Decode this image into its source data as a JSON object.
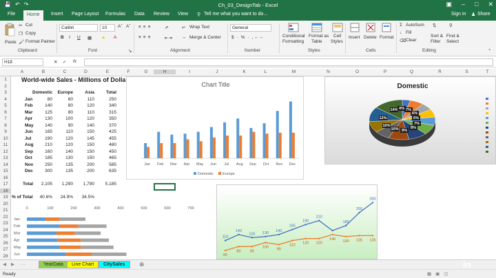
{
  "window": {
    "title": "Ch_03_DesignTab - Excel",
    "signin": "Sign in",
    "share": "Share"
  },
  "tabs": [
    "File",
    "Home",
    "Insert",
    "Page Layout",
    "Formulas",
    "Data",
    "Review",
    "View"
  ],
  "tell_me": "Tell me what you want to do...",
  "ribbon": {
    "cut": "Cut",
    "copy": "Copy",
    "format_painter": "Format Painter",
    "paste": "Paste",
    "font_name": "Calibri",
    "font_size": "10",
    "bold": "B",
    "italic": "I",
    "underline": "U",
    "wrap_text": "Wrap Text",
    "merge_center": "Merge & Center",
    "number_format": "General",
    "conditional_formatting": [
      "Conditional",
      "Formatting"
    ],
    "format_as_table": [
      "Format as",
      "Table"
    ],
    "cell_styles": [
      "Cell",
      "Styles"
    ],
    "insert": "Insert",
    "delete": "Delete",
    "format": "Format",
    "autosum": "AutoSum",
    "fill": "Fill",
    "clear": "Clear",
    "sort_filter": [
      "Sort &",
      "Filter"
    ],
    "find_select": [
      "Find &",
      "Select"
    ],
    "groups": [
      "Clipboard",
      "Font",
      "Alignment",
      "Number",
      "Styles",
      "Cells",
      "Editing"
    ]
  },
  "name_box": "H18",
  "fx": "fx",
  "columns": [
    "A",
    "B",
    "C",
    "D",
    "E",
    "F",
    "G",
    "H",
    "I",
    "J",
    "K",
    "L",
    "M",
    "N",
    "O",
    "P",
    "Q",
    "R",
    "S",
    "T",
    "U"
  ],
  "rows": [
    "1",
    "2",
    "3",
    "4",
    "5",
    "6",
    "7",
    "8",
    "9",
    "10",
    "11",
    "12",
    "13",
    "14",
    "15",
    "16",
    "17",
    "18",
    "19",
    "20",
    "21",
    "22",
    "23",
    "24",
    "25",
    "26",
    "27",
    "28"
  ],
  "sheet": {
    "title": "World-wide Sales - Millions of Dollar",
    "headers": [
      "Domestic",
      "Europe",
      "Asia",
      "Total"
    ],
    "months": [
      "Jan",
      "Feb",
      "Mar",
      "Apr",
      "May",
      "Jun",
      "Jul",
      "Aug",
      "Sep",
      "Oct",
      "Nov",
      "Dec"
    ],
    "data": [
      [
        "80",
        "60",
        "110",
        "250"
      ],
      [
        "140",
        "80",
        "120",
        "340"
      ],
      [
        "125",
        "80",
        "110",
        "315"
      ],
      [
        "130",
        "100",
        "120",
        "350"
      ],
      [
        "140",
        "90",
        "140",
        "370"
      ],
      [
        "165",
        "110",
        "150",
        "425"
      ],
      [
        "190",
        "120",
        "145",
        "455"
      ],
      [
        "210",
        "120",
        "150",
        "480"
      ],
      [
        "160",
        "140",
        "150",
        "450"
      ],
      [
        "185",
        "130",
        "150",
        "465"
      ],
      [
        "250",
        "135",
        "200",
        "585"
      ],
      [
        "300",
        "135",
        "200",
        "635"
      ]
    ],
    "total_label": "Total",
    "totals": [
      "2,105",
      "1,290",
      "1,790",
      "5,185"
    ],
    "pct_label": "% of Total",
    "pcts": [
      "40.6%",
      "24.9%",
      "34.5%"
    ]
  },
  "chart_data": [
    {
      "type": "bar",
      "title": "Chart Title",
      "categories": [
        "Jan",
        "Feb",
        "Mar",
        "Apr",
        "May",
        "Jun",
        "Jul",
        "Aug",
        "Sep",
        "Oct",
        "Nov",
        "Dec"
      ],
      "series": [
        {
          "name": "Domestic",
          "values": [
            80,
            140,
            125,
            130,
            140,
            165,
            190,
            210,
            160,
            185,
            250,
            300
          ],
          "color": "#5b9bd5"
        },
        {
          "name": "Europe",
          "values": [
            60,
            80,
            80,
            100,
            90,
            110,
            120,
            120,
            140,
            130,
            135,
            135
          ],
          "color": "#ed7d31"
        }
      ],
      "ylim": [
        0,
        320
      ],
      "grid": false,
      "legend": "bottom"
    },
    {
      "type": "pie",
      "title": "Domestic",
      "labels": [
        "Jan",
        "Feb",
        "Mar",
        "Apr",
        "May",
        "Jun",
        "Jul",
        "Aug",
        "Sep",
        "Oct",
        "Nov",
        "Dec"
      ],
      "values": [
        80,
        140,
        125,
        130,
        140,
        165,
        190,
        210,
        160,
        185,
        250,
        300
      ],
      "visible_percent_labels": [
        "14%",
        "4%",
        "7%",
        "6%",
        "6%",
        "7%",
        "8%",
        "9%",
        "10%",
        "10%",
        "12%"
      ],
      "legend": "right"
    },
    {
      "type": "line",
      "series": [
        {
          "values": [
            110,
            140,
            125,
            130,
            140,
            165,
            190,
            210,
            160,
            185,
            250,
            300
          ],
          "labels": [
            "110",
            "140",
            "125",
            "130",
            "140",
            "165",
            "190",
            "210",
            "185",
            "250",
            "300"
          ],
          "color": "#4472c4"
        },
        {
          "values": [
            60,
            80,
            80,
            100,
            90,
            110,
            120,
            120,
            140,
            130,
            135,
            135
          ],
          "labels": [
            "60",
            "80",
            "80",
            "100",
            "90",
            "110",
            "120",
            "120",
            "140",
            "130",
            "135",
            "135"
          ],
          "color": "#ed7d31"
        }
      ],
      "grid": false
    },
    {
      "type": "bar",
      "orientation": "horizontal",
      "stacked": true,
      "categories": [
        "Jan",
        "Feb",
        "Mar",
        "Apr",
        "May",
        "Jun"
      ],
      "series": [
        {
          "values": [
            80,
            140,
            125,
            130,
            140,
            165
          ],
          "color": "#5b9bd5"
        },
        {
          "values": [
            60,
            80,
            80,
            100,
            90,
            110
          ],
          "color": "#ed7d31"
        },
        {
          "values": [
            110,
            120,
            110,
            120,
            140,
            150
          ],
          "color": "#a5a5a5"
        }
      ],
      "xticks": [
        "0",
        "100",
        "200",
        "300",
        "400",
        "500",
        "600",
        "700"
      ],
      "xlim": [
        0,
        700
      ]
    }
  ],
  "sheet_tabs": [
    "YearData",
    "Line Chart",
    "CitySales"
  ],
  "status": "Ready",
  "watermark": "Linked in"
}
